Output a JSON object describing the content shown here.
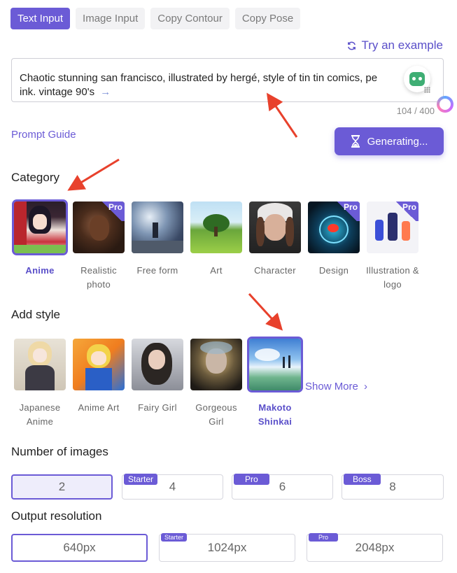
{
  "tabs": [
    {
      "label": "Text Input",
      "active": true
    },
    {
      "label": "Image Input",
      "active": false
    },
    {
      "label": "Copy Contour",
      "active": false
    },
    {
      "label": "Copy Pose",
      "active": false
    }
  ],
  "try_example": {
    "label": "Try an example",
    "icon": "refresh-icon"
  },
  "prompt": {
    "text": "Chaotic stunning san francisco, illustrated by hergé, style of tin tin comics, pe",
    "text_line2": "ink. vintage 90's",
    "trailing_arrow": "→",
    "counter": "104 / 400"
  },
  "prompt_guide": "Prompt Guide",
  "generate_button": {
    "label": "Generating...",
    "icon": "hourglass-icon"
  },
  "category": {
    "title": "Category",
    "items": [
      {
        "label": "Anime",
        "selected": true,
        "pro": false
      },
      {
        "label": "Realistic photo",
        "selected": false,
        "pro": true
      },
      {
        "label": "Free form",
        "selected": false,
        "pro": false
      },
      {
        "label": "Art",
        "selected": false,
        "pro": false
      },
      {
        "label": "Character",
        "selected": false,
        "pro": false
      },
      {
        "label": "Design",
        "selected": false,
        "pro": true
      },
      {
        "label": "Illustration & logo",
        "selected": false,
        "pro": true
      }
    ]
  },
  "style": {
    "title": "Add style",
    "items": [
      {
        "label": "Japanese Anime",
        "selected": false
      },
      {
        "label": "Anime Art",
        "selected": false
      },
      {
        "label": "Fairy Girl",
        "selected": false
      },
      {
        "label": "Gorgeous Girl",
        "selected": false
      },
      {
        "label": "Makoto Shinkai",
        "selected": true
      }
    ],
    "show_more": "Show More"
  },
  "pro_label": "Pro",
  "number_of_images": {
    "title": "Number of images",
    "options": [
      {
        "value": "2",
        "tag": "",
        "selected": true
      },
      {
        "value": "4",
        "tag": "Starter",
        "selected": false
      },
      {
        "value": "6",
        "tag": "Pro",
        "selected": false
      },
      {
        "value": "8",
        "tag": "Boss",
        "selected": false
      }
    ]
  },
  "output_resolution": {
    "title": "Output resolution",
    "options": [
      {
        "value": "640px",
        "tag": "",
        "selected": true
      },
      {
        "value": "1024px",
        "tag": "Starter",
        "selected": false
      },
      {
        "value": "2048px",
        "tag": "Pro",
        "selected": false
      }
    ]
  },
  "colors": {
    "accent": "#6b5bd6",
    "annotation_arrow": "#e8412c"
  }
}
